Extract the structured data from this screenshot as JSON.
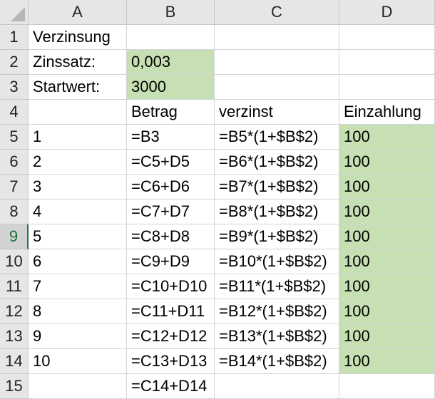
{
  "columns": [
    "A",
    "B",
    "C",
    "D"
  ],
  "rows": [
    "1",
    "2",
    "3",
    "4",
    "5",
    "6",
    "7",
    "8",
    "9",
    "10",
    "11",
    "12",
    "13",
    "14",
    "15"
  ],
  "active_row": "9",
  "colors": {
    "header_bg": "#e6e6e6",
    "highlight": "#c6e0b4",
    "gridline": "#d4d4d4",
    "active_accent": "#217346"
  },
  "cells": {
    "A1": "Verzinsung",
    "A2": "Zinssatz:",
    "B2": "0,003",
    "A3": "Startwert:",
    "B3": "3000",
    "B4": "Betrag",
    "C4": "verzinst",
    "D4": "Einzahlung",
    "A5": "1",
    "B5": "=B3",
    "C5": "=B5*(1+$B$2)",
    "D5": "100",
    "A6": "2",
    "B6": "=C5+D5",
    "C6": "=B6*(1+$B$2)",
    "D6": "100",
    "A7": "3",
    "B7": "=C6+D6",
    "C7": "=B7*(1+$B$2)",
    "D7": "100",
    "A8": "4",
    "B8": "=C7+D7",
    "C8": "=B8*(1+$B$2)",
    "D8": "100",
    "A9": "5",
    "B9": "=C8+D8",
    "C9": "=B9*(1+$B$2)",
    "D9": "100",
    "A10": "6",
    "B10": "=C9+D9",
    "C10": "=B10*(1+$B$2)",
    "D10": "100",
    "A11": "7",
    "B11": "=C10+D10",
    "C11": "=B11*(1+$B$2)",
    "D11": "100",
    "A12": "8",
    "B12": "=C11+D11",
    "C12": "=B12*(1+$B$2)",
    "D12": "100",
    "A13": "9",
    "B13": "=C12+D12",
    "C13": "=B13*(1+$B$2)",
    "D13": "100",
    "A14": "10",
    "B14": "=C13+D13",
    "C14": "=B14*(1+$B$2)",
    "D14": "100",
    "B15": "=C14+D14"
  },
  "highlighted_cells": [
    "B2",
    "B3",
    "D5",
    "D6",
    "D7",
    "D8",
    "D9",
    "D10",
    "D11",
    "D12",
    "D13",
    "D14"
  ]
}
